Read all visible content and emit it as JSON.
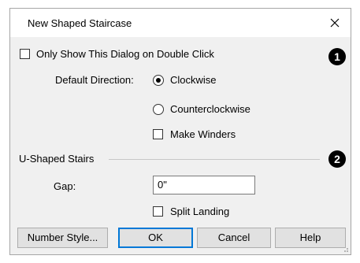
{
  "window": {
    "title": "New Shaped Staircase",
    "close_icon": "close-icon"
  },
  "options": {
    "only_show_on_double_click": {
      "label": "Only Show This Dialog on Double Click",
      "checked": false
    },
    "default_direction": {
      "label": "Default Direction:",
      "options": [
        "Clockwise",
        "Counterclockwise"
      ],
      "selected": "Clockwise"
    },
    "make_winders": {
      "label": "Make Winders",
      "checked": false
    }
  },
  "u_shaped": {
    "title": "U-Shaped Stairs",
    "gap_label": "Gap:",
    "gap_value": "0\"",
    "split_landing": {
      "label": "Split Landing",
      "checked": false
    }
  },
  "callouts": [
    "1",
    "2"
  ],
  "buttons": {
    "number_style": "Number Style...",
    "ok": "OK",
    "cancel": "Cancel",
    "help": "Help"
  }
}
